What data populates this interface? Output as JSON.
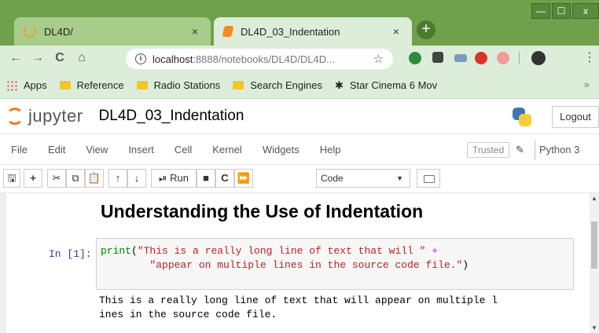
{
  "browser": {
    "tabs": [
      {
        "title": "DL4D/",
        "close": "×"
      },
      {
        "title": "DL4D_03_Indentation",
        "close": "×"
      }
    ],
    "new_tab": "+",
    "window_controls": {
      "minimize": "—",
      "maximize": "☐",
      "close": "x"
    },
    "nav": {
      "back": "←",
      "forward": "→",
      "reload": "C",
      "home": "⌂"
    },
    "url_host": "localhost",
    "url_rest": ":8888/notebooks/DL4D/DL4D...",
    "menu_glyph": "⋮",
    "bookmarks": [
      {
        "label": "Apps",
        "icon": "apps-grid-icon"
      },
      {
        "label": "Reference",
        "icon": "folder-icon"
      },
      {
        "label": "Radio Stations",
        "icon": "folder-icon"
      },
      {
        "label": "Search Engines",
        "icon": "folder-icon"
      },
      {
        "label": "Star Cinema 6 Mov",
        "icon": "star-cinema-icon"
      }
    ],
    "bookmarks_more": "»"
  },
  "jupyter": {
    "logo_text": "jupyter",
    "notebook_name": "DL4D_03_Indentation",
    "logout": "Logout",
    "menu": [
      "File",
      "Edit",
      "View",
      "Insert",
      "Cell",
      "Kernel",
      "Widgets",
      "Help"
    ],
    "trusted": "Trusted",
    "kernel": "Python 3",
    "toolbar": {
      "run_label": "Run",
      "cell_type": "Code"
    }
  },
  "notebook": {
    "heading": "Understanding the Use of Indentation",
    "prompt": "In [1]:",
    "code_line1": {
      "kw": "print",
      "open": "(",
      "str": "\"This is a really long line of text that will \"",
      "op": " +"
    },
    "code_line2": {
      "indent": "        ",
      "str": "\"appear on multiple lines in the source code file.\"",
      "close": ")"
    },
    "output_line1": "This is a really long line of text that will appear on multiple l",
    "output_line2": "ines in the source code file."
  },
  "colors": {
    "chrome_frame": "#6fa14c",
    "tab_active": "#dceeda",
    "jupyter_orange": "#f37726",
    "prompt_blue": "#303f9f",
    "code_keyword": "#008000",
    "code_string": "#ba2121"
  }
}
